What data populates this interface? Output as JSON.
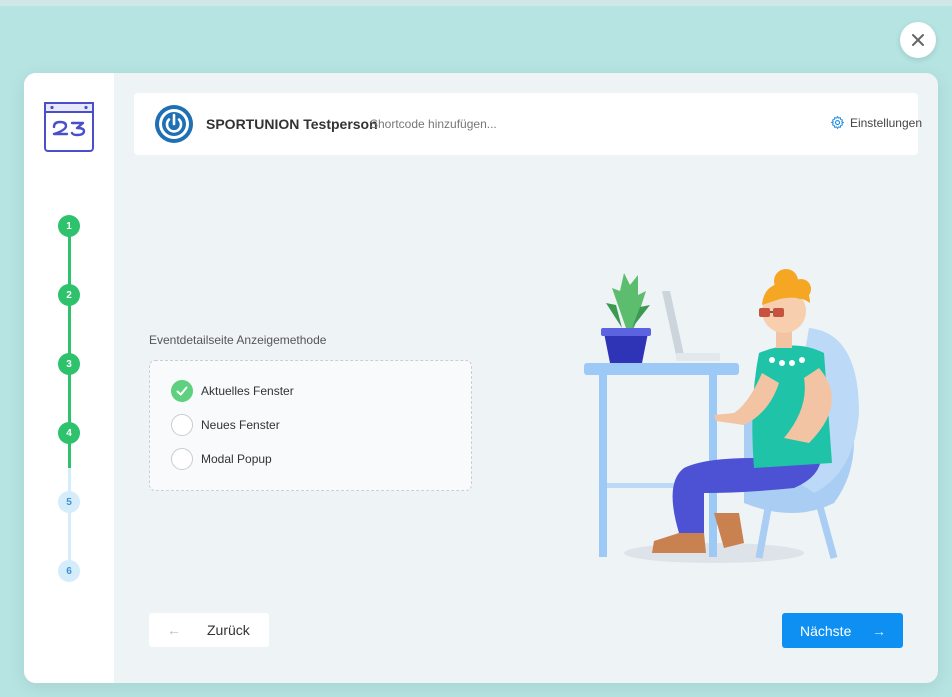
{
  "header": {
    "title": "SPORTUNION Testperson",
    "shortcode_placeholder": "Shortcode hinzufügen...",
    "settings_label": "Einstellungen"
  },
  "steps": [
    {
      "label": "1",
      "status": "done"
    },
    {
      "label": "2",
      "status": "done"
    },
    {
      "label": "3",
      "status": "done"
    },
    {
      "label": "4",
      "status": "done"
    },
    {
      "label": "5",
      "status": "todo"
    },
    {
      "label": "6",
      "status": "todo"
    }
  ],
  "form": {
    "field_label": "Eventdetailseite Anzeigemethode",
    "options": [
      {
        "label": "Aktuelles Fenster",
        "checked": true
      },
      {
        "label": "Neues Fenster",
        "checked": false
      },
      {
        "label": "Modal Popup",
        "checked": false
      }
    ]
  },
  "footer": {
    "back_label": "Zurück",
    "back_icon": "arrow-left-icon",
    "next_label": "Nächste",
    "next_icon": "arrow-right-icon"
  },
  "icons": {
    "close": "close-icon",
    "settings": "gear-icon",
    "app_logo": "calendar-23-logo",
    "brand_logo": "power-logo"
  },
  "colors": {
    "page_background": "#b5e4e2",
    "step_done": "#2dc26b",
    "step_todo": "#d5ecfa",
    "primary_button": "#0e90f2",
    "checked_radio": "#5fcf80"
  }
}
